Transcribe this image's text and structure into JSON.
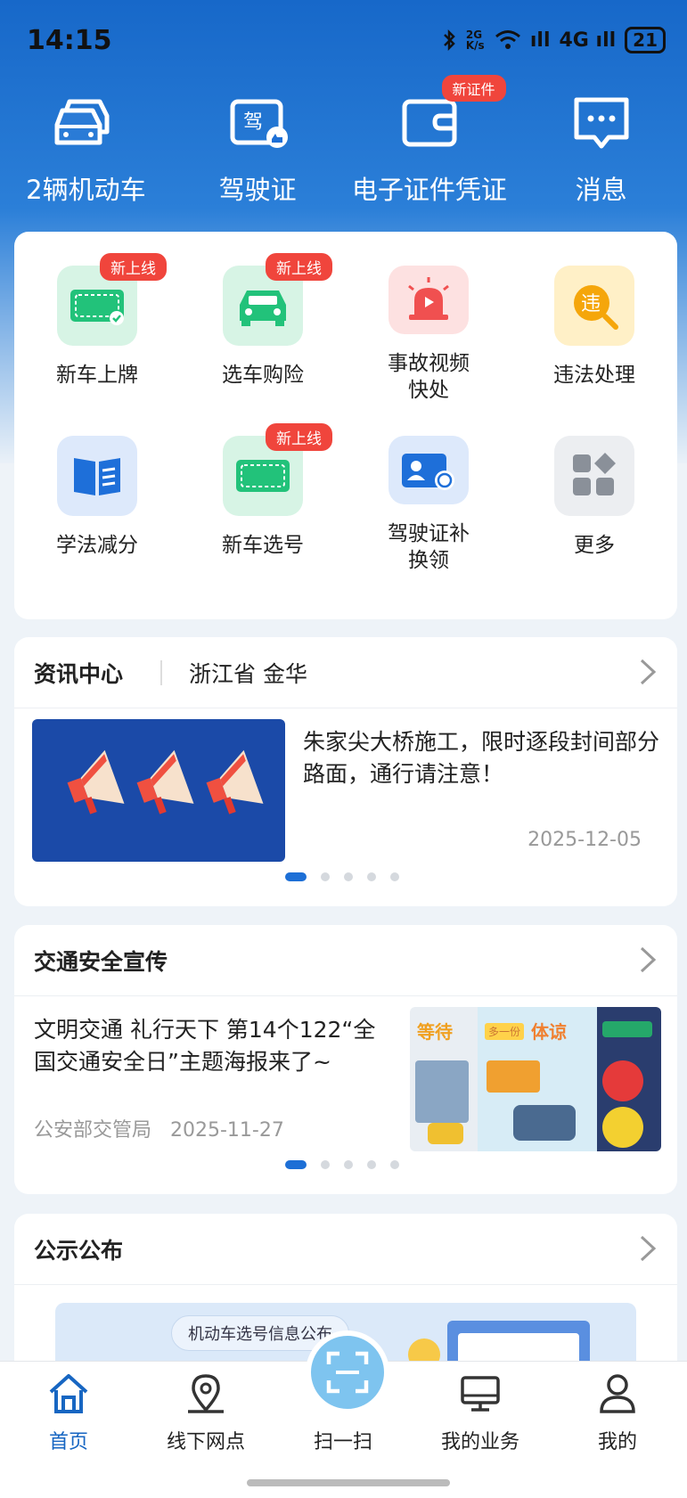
{
  "status_bar": {
    "time": "14:15",
    "network": "2G K/s",
    "signal1": "ıll",
    "signal2": "4G ıll",
    "battery": "21"
  },
  "top_shortcuts": [
    {
      "label": "2辆机动车",
      "icon": "car-icon"
    },
    {
      "label": "驾驶证",
      "icon": "license-card-icon"
    },
    {
      "label": "电子证件凭证",
      "icon": "wallet-icon",
      "badge": "新证件"
    },
    {
      "label": "消息",
      "icon": "message-icon"
    }
  ],
  "services": [
    {
      "label": "新车上牌",
      "icon": "plate-icon",
      "badge": "新上线"
    },
    {
      "label": "选车购险",
      "icon": "car-insurance-icon",
      "badge": "新上线"
    },
    {
      "label": "事故视频\n快处",
      "icon": "alarm-light-icon"
    },
    {
      "label": "违法处理",
      "icon": "violation-icon"
    },
    {
      "label": "学法减分",
      "icon": "book-icon"
    },
    {
      "label": "新车选号",
      "icon": "plate-select-icon",
      "badge": "新上线"
    },
    {
      "label": "驾驶证补\n换领",
      "icon": "id-card-icon"
    },
    {
      "label": "更多",
      "icon": "more-apps-icon"
    }
  ],
  "news": {
    "title": "资讯中心",
    "region": "浙江省 金华",
    "headline": "朱家尖大桥施工，限时逐段封间部分路面，通行请注意！",
    "date": "2025-12-05"
  },
  "safety": {
    "title": "交通安全宣传",
    "headline": "文明交通 礼行天下 第14个122“全国交通安全日”主题海报来了~",
    "source": "公安部交管局",
    "date": "2025-11-27",
    "poster_words": [
      "等待",
      "多一份",
      "体谅"
    ]
  },
  "notice": {
    "title": "公示公布",
    "banner_label": "机动车选号信息公布"
  },
  "tabbar": [
    {
      "label": "首页",
      "icon": "home-icon",
      "active": true
    },
    {
      "label": "线下网点",
      "icon": "location-icon"
    },
    {
      "label": "扫一扫",
      "icon": "scan-icon"
    },
    {
      "label": "我的业务",
      "icon": "monitor-icon"
    },
    {
      "label": "我的",
      "icon": "user-icon"
    }
  ],
  "colors": {
    "brand_blue": "#1768c9",
    "badge_red": "#f0453c",
    "active_tab": "#1766c2"
  }
}
